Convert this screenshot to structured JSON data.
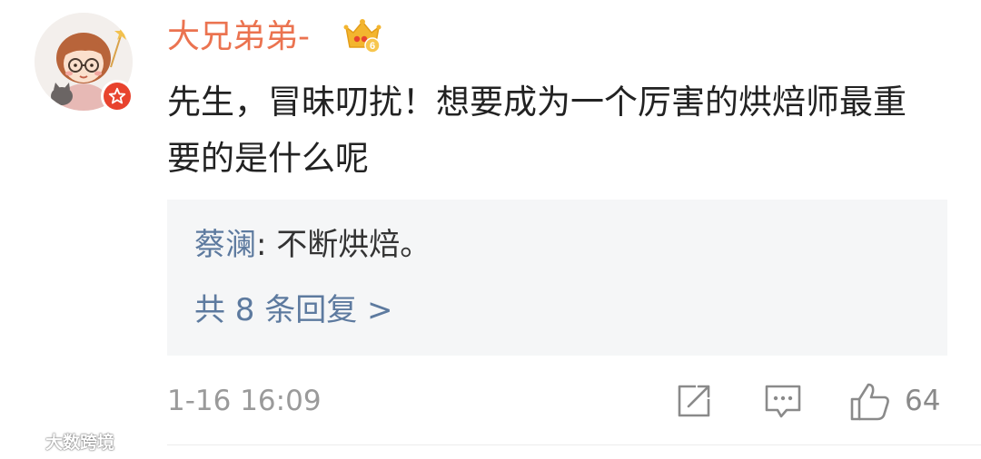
{
  "comment": {
    "username": "大兄弟弟-",
    "member_level": "6",
    "text": "先生，冒昧叨扰！想要成为一个厉害的烘焙师最重要的是什么呢",
    "timestamp": "1-16 16:09",
    "like_count": "64"
  },
  "reply_preview": {
    "author": "蔡澜",
    "separator": ": ",
    "text": "不断烘焙。",
    "more_replies_label": "共 8 条回复 >"
  },
  "icons": {
    "avatar": "cartoon-girl-avatar",
    "verified": "red-star-badge-icon",
    "member": "gold-crown-icon",
    "share": "share-icon",
    "comment": "comment-icon",
    "like": "thumbs-up-icon"
  },
  "watermark": "大数跨境",
  "colors": {
    "username": "#eb7350",
    "link": "#5d7a9f",
    "text": "#222222",
    "meta": "#9a9a9a",
    "reply_bg": "#f5f6f7",
    "badge": "#e8432e",
    "crown": "#f3b52f"
  }
}
